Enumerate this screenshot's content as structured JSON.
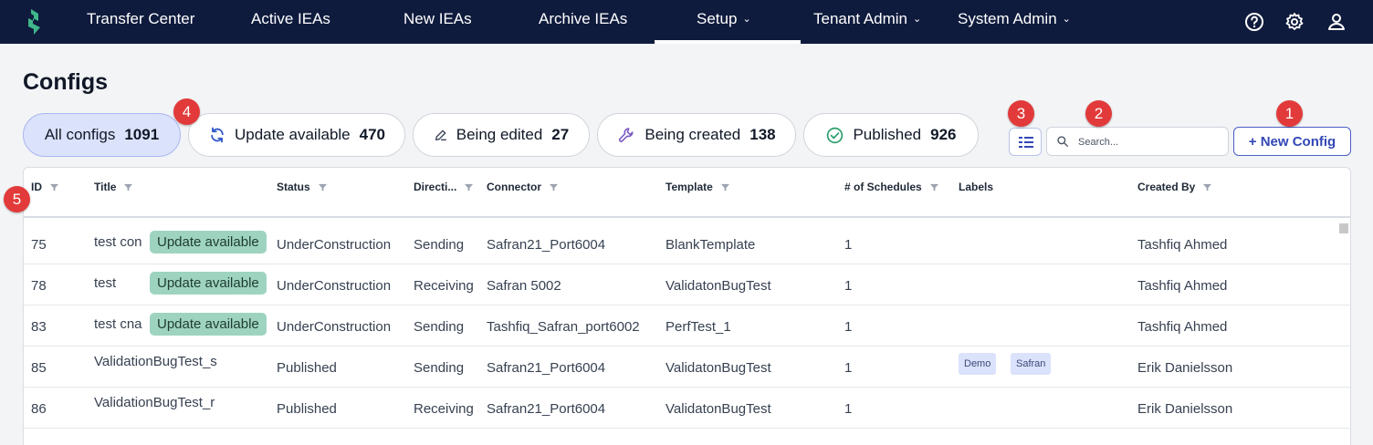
{
  "nav": {
    "items": [
      {
        "label": "Transfer Center"
      },
      {
        "label": "Active IEAs"
      },
      {
        "label": "New IEAs"
      },
      {
        "label": "Archive IEAs"
      },
      {
        "label": "Setup",
        "active": true
      },
      {
        "label": "Tenant Admin"
      },
      {
        "label": "System Admin"
      }
    ],
    "icons": [
      "help-icon",
      "gear-icon",
      "user-icon"
    ]
  },
  "page": {
    "title": "Configs"
  },
  "filters": [
    {
      "label": "All configs",
      "count": "1091",
      "active": true
    },
    {
      "label": "Update available",
      "count": "470",
      "icon": "refresh-icon"
    },
    {
      "label": "Being edited",
      "count": "27",
      "icon": "pencil-icon"
    },
    {
      "label": "Being created",
      "count": "138",
      "icon": "wrench-icon"
    },
    {
      "label": "Published",
      "count": "926",
      "icon": "check-circle-icon"
    }
  ],
  "markers": [
    "1",
    "2",
    "3",
    "4",
    "5"
  ],
  "search": {
    "placeholder": "Search..."
  },
  "new_button": "+ New Config",
  "table": {
    "columns": [
      "ID",
      "Title",
      "Status",
      "Directi...",
      "Connector",
      "Template",
      "# of Schedules",
      "Labels",
      "Created By"
    ],
    "rows": [
      {
        "id": "75",
        "title": "test con",
        "badge": "Update available",
        "status": "UnderConstruction",
        "direction": "Sending",
        "connector": "Safran21_Port6004",
        "template": "BlankTemplate",
        "schedules": "1",
        "labels": [],
        "created_by": "Tashfiq Ahmed"
      },
      {
        "id": "78",
        "title": "test",
        "badge": "Update available",
        "status": "UnderConstruction",
        "direction": "Receiving",
        "connector": "Safran 5002",
        "template": "ValidatonBugTest",
        "schedules": "1",
        "labels": [],
        "created_by": "Tashfiq Ahmed"
      },
      {
        "id": "83",
        "title": "test cna",
        "badge": "Update available",
        "status": "UnderConstruction",
        "direction": "Sending",
        "connector": "Tashfiq_Safran_port6002",
        "template": "PerfTest_1",
        "schedules": "1",
        "labels": [],
        "created_by": "Tashfiq Ahmed"
      },
      {
        "id": "85",
        "title": "ValidationBugTest_s",
        "badge": "",
        "status": "Published",
        "direction": "Sending",
        "connector": "Safran21_Port6004",
        "template": "ValidatonBugTest",
        "schedules": "1",
        "labels": [
          "Demo",
          "Safran"
        ],
        "created_by": "Erik Danielsson"
      },
      {
        "id": "86",
        "title": "ValidationBugTest_r",
        "badge": "",
        "status": "Published",
        "direction": "Receiving",
        "connector": "Safran21_Port6004",
        "template": "ValidatonBugTest",
        "schedules": "1",
        "labels": [],
        "created_by": "Erik Danielsson"
      }
    ]
  },
  "colors": {
    "nav_bg": "#0f1b3d",
    "accent": "#3347b5",
    "badge_bg": "#9ed4bf",
    "marker": "#e23a3a"
  }
}
